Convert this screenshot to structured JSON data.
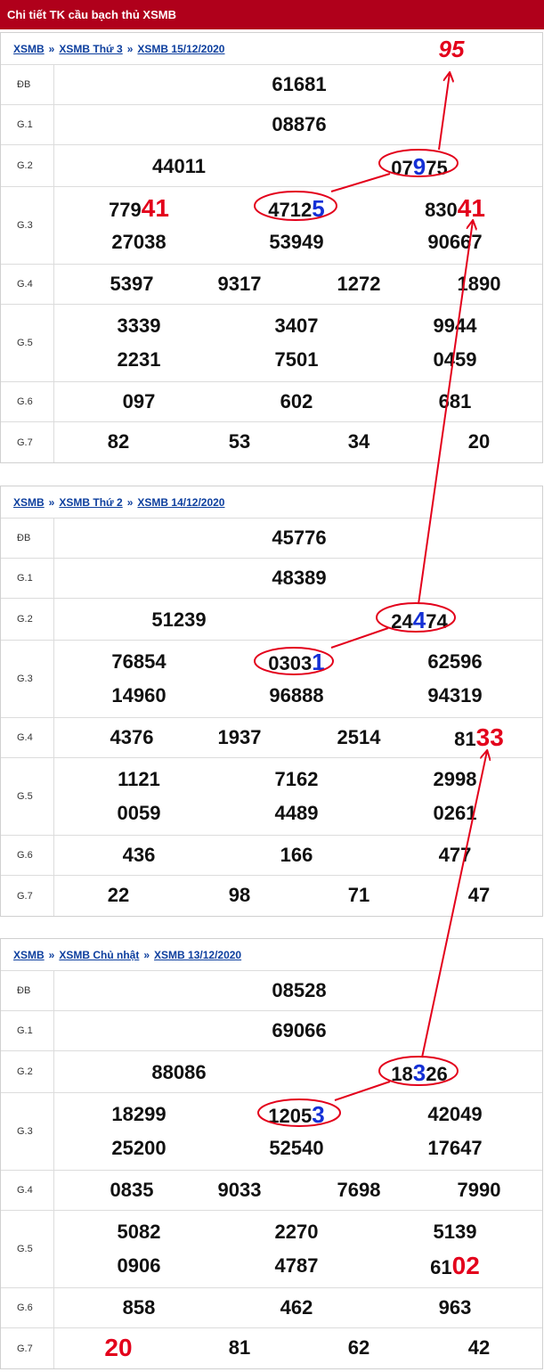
{
  "header": {
    "title": "Chi tiết TK cầu bạch thủ XSMB"
  },
  "predicted": "95",
  "sections": [
    {
      "crumbs": [
        "XSMB",
        "XSMB Thứ 3",
        "XSMB 15/12/2020"
      ],
      "rows": [
        {
          "label": "ĐB",
          "cells": [
            [
              "61681"
            ]
          ]
        },
        {
          "label": "G.1",
          "cells": [
            [
              "08876"
            ]
          ]
        },
        {
          "label": "G.2",
          "cells": [
            [
              "44011"
            ],
            [
              "07",
              "9",
              "75"
            ]
          ]
        },
        {
          "label": "G.3",
          "cells": [
            [
              "779",
              "41",
              ""
            ],
            [
              "4712",
              "5",
              ""
            ],
            [
              "830",
              "41",
              ""
            ],
            [
              "27038"
            ],
            [
              "53949"
            ],
            [
              "90667"
            ]
          ]
        },
        {
          "label": "G.4",
          "cells": [
            [
              "5397"
            ],
            [
              "9317"
            ],
            [
              "1272"
            ],
            [
              "1890"
            ]
          ]
        },
        {
          "label": "G.5",
          "cells": [
            [
              "3339"
            ],
            [
              "3407"
            ],
            [
              "9944"
            ],
            [
              "2231"
            ],
            [
              "7501"
            ],
            [
              "0459"
            ]
          ]
        },
        {
          "label": "G.6",
          "cells": [
            [
              "097"
            ],
            [
              "602"
            ],
            [
              "681"
            ]
          ]
        },
        {
          "label": "G.7",
          "cells": [
            [
              "82"
            ],
            [
              "53"
            ],
            [
              "34"
            ],
            [
              "20"
            ]
          ]
        }
      ]
    },
    {
      "crumbs": [
        "XSMB",
        "XSMB Thứ 2",
        "XSMB 14/12/2020"
      ],
      "rows": [
        {
          "label": "ĐB",
          "cells": [
            [
              "45776"
            ]
          ]
        },
        {
          "label": "G.1",
          "cells": [
            [
              "48389"
            ]
          ]
        },
        {
          "label": "G.2",
          "cells": [
            [
              "51239"
            ],
            [
              "24",
              "4",
              "74"
            ]
          ]
        },
        {
          "label": "G.3",
          "cells": [
            [
              "76854"
            ],
            [
              "0303",
              "1",
              ""
            ],
            [
              "62596"
            ],
            [
              "14960"
            ],
            [
              "96888"
            ],
            [
              "94319"
            ]
          ]
        },
        {
          "label": "G.4",
          "cells": [
            [
              "4376"
            ],
            [
              "1937"
            ],
            [
              "2514"
            ],
            [
              "81",
              "33",
              ""
            ]
          ]
        },
        {
          "label": "G.5",
          "cells": [
            [
              "1121"
            ],
            [
              "7162"
            ],
            [
              "2998"
            ],
            [
              "0059"
            ],
            [
              "4489"
            ],
            [
              "0261"
            ]
          ]
        },
        {
          "label": "G.6",
          "cells": [
            [
              "436"
            ],
            [
              "166"
            ],
            [
              "477"
            ]
          ]
        },
        {
          "label": "G.7",
          "cells": [
            [
              "22"
            ],
            [
              "98"
            ],
            [
              "71"
            ],
            [
              "47"
            ]
          ]
        }
      ]
    },
    {
      "crumbs": [
        "XSMB",
        "XSMB Chủ nhật",
        "XSMB 13/12/2020"
      ],
      "rows": [
        {
          "label": "ĐB",
          "cells": [
            [
              "08528"
            ]
          ]
        },
        {
          "label": "G.1",
          "cells": [
            [
              "69066"
            ]
          ]
        },
        {
          "label": "G.2",
          "cells": [
            [
              "88086"
            ],
            [
              "18",
              "3",
              "26"
            ]
          ]
        },
        {
          "label": "G.3",
          "cells": [
            [
              "18299"
            ],
            [
              "1205",
              "3",
              ""
            ],
            [
              "42049"
            ],
            [
              "25200"
            ],
            [
              "52540"
            ],
            [
              "17647"
            ]
          ]
        },
        {
          "label": "G.4",
          "cells": [
            [
              "0835"
            ],
            [
              "9033"
            ],
            [
              "7698"
            ],
            [
              "7990"
            ]
          ]
        },
        {
          "label": "G.5",
          "cells": [
            [
              "5082"
            ],
            [
              "2270"
            ],
            [
              "5139"
            ],
            [
              "0906"
            ],
            [
              "4787"
            ],
            [
              "61",
              "02",
              ""
            ]
          ]
        },
        {
          "label": "G.6",
          "cells": [
            [
              "858"
            ],
            [
              "462"
            ],
            [
              "963"
            ]
          ]
        },
        {
          "label": "G.7",
          "cells": [
            [
              "",
              "20",
              ""
            ],
            [
              "81"
            ],
            [
              "62"
            ],
            [
              "42"
            ]
          ]
        }
      ]
    }
  ],
  "colors": {
    "header": "#b0001b",
    "highlight_red": "#e3001b",
    "highlight_blue": "#1430d6",
    "link": "#0d3f9e"
  }
}
